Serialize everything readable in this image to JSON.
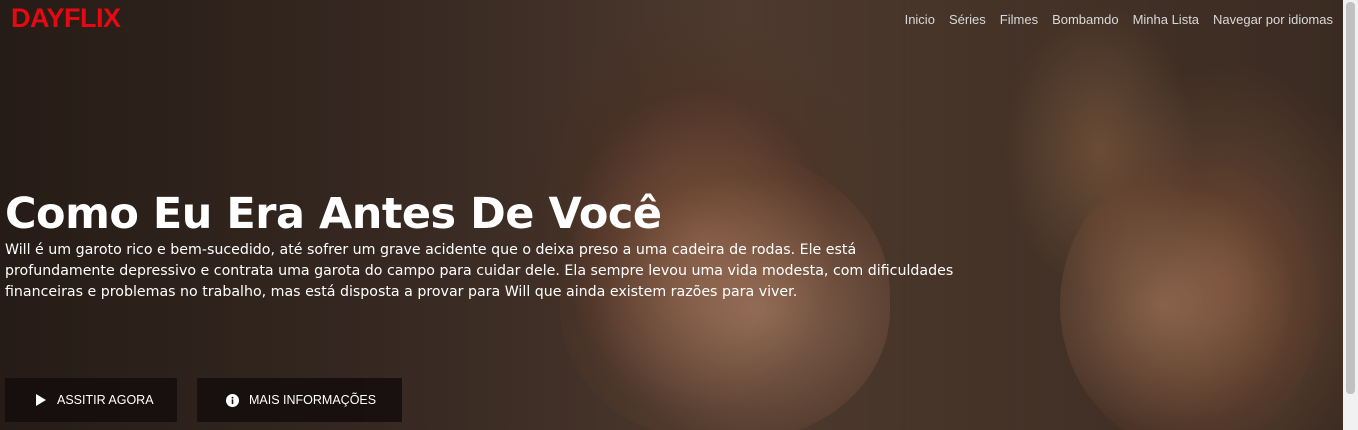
{
  "brand": {
    "logo": "DAYFLIX",
    "color": "#e50914"
  },
  "nav": {
    "items": [
      {
        "label": "Inicio"
      },
      {
        "label": "Séries"
      },
      {
        "label": "Filmes"
      },
      {
        "label": "Bombamdo"
      },
      {
        "label": "Minha Lista"
      },
      {
        "label": "Navegar por idiomas"
      }
    ]
  },
  "hero": {
    "title": "Como Eu Era Antes De Você",
    "description": "Will é um garoto rico e bem-sucedido, até sofrer um grave acidente que o deixa preso a uma cadeira de rodas. Ele está profundamente depressivo e contrata uma garota do campo para cuidar dele. Ela sempre levou uma vida modesta, com dificuldades financeiras e problemas no trabalho, mas está disposta a provar para Will que ainda existem razões para viver.",
    "buttons": {
      "play_label": "ASSITIR AGORA",
      "play_icon": "play-icon",
      "info_label": "MAIS INFORMAÇÕES",
      "info_icon": "info-icon"
    }
  }
}
